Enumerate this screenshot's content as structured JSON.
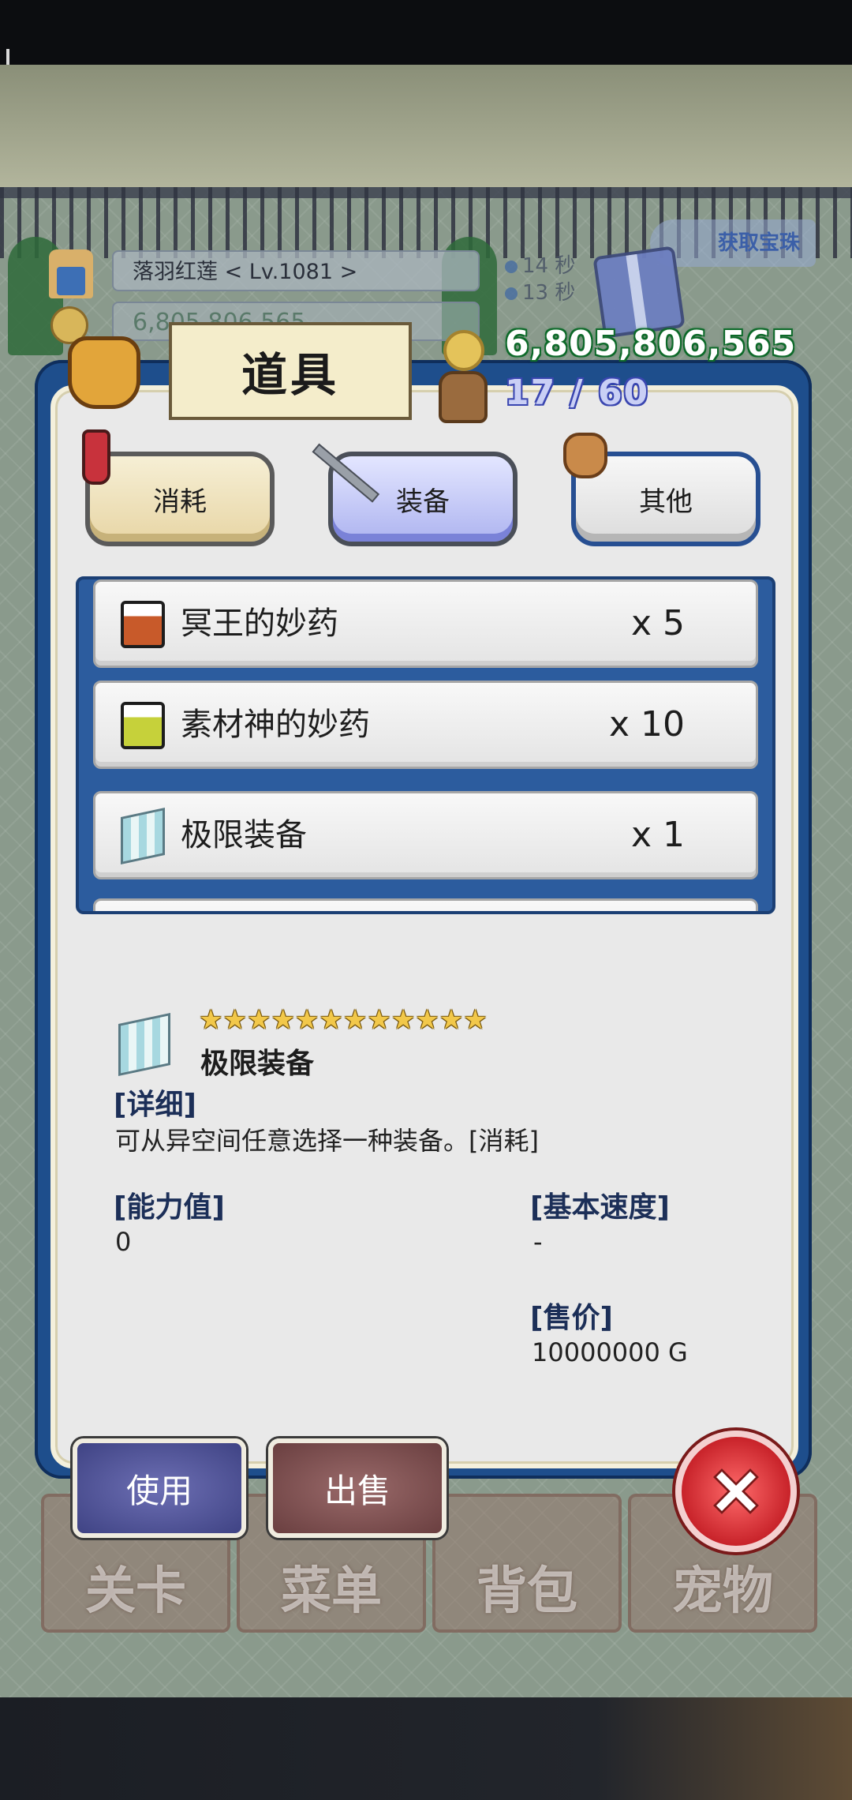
{
  "hud": {
    "player_name_level": "落羽红莲   < Lv.1081 >",
    "gold_small": "6,805,806,565",
    "timer_1": "14 秒",
    "timer_2": "13 秒",
    "get_diamond": "获取宝珠"
  },
  "panel": {
    "title": "道具",
    "gold": "6,805,806,565",
    "capacity": "17 / 60",
    "tabs": [
      {
        "label": "消耗"
      },
      {
        "label": "装备"
      },
      {
        "label": "其他"
      }
    ],
    "selected_tab": "装备",
    "items": [
      {
        "name": "冥王的妙药",
        "qty": "x 5",
        "icon": "potion-icon"
      },
      {
        "name": "素材神的妙药",
        "qty": "x 10",
        "icon": "potion-icon"
      },
      {
        "name": "极限装备",
        "qty": "x 1",
        "icon": "cube-icon"
      }
    ]
  },
  "detail": {
    "stars": "★★★★★★★★★★★★",
    "star_count": 12,
    "name": "极限装备",
    "desc_header": "[详细]",
    "desc": "可从异空间任意选择一种装备。[消耗]",
    "power_header": "[能力值]",
    "power": "0",
    "speed_header": "[基本速度]",
    "speed": "-",
    "price_header": "[售价]",
    "price": "10000000 G"
  },
  "buttons": {
    "use": "使用",
    "sell": "出售"
  },
  "bottom_nav": [
    "关卡",
    "菜单",
    "背包",
    "宠物"
  ],
  "colors": {
    "panel_blue": "#1e4e8c",
    "gold_outline": "#0e6a2a",
    "capacity_outline": "#3a46b0",
    "close_red": "#c8232a"
  }
}
